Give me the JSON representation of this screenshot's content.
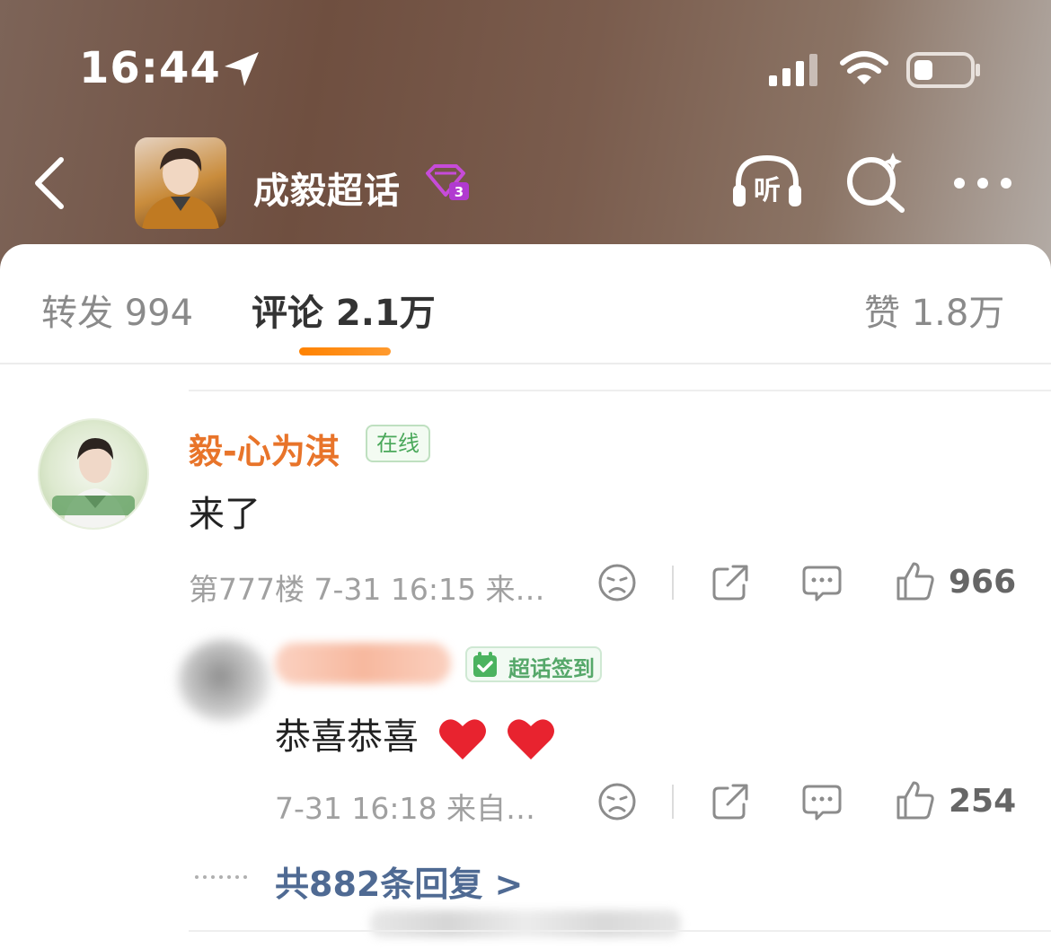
{
  "status_bar": {
    "time": "16:44"
  },
  "header": {
    "title": "成毅超话",
    "level": "3",
    "listen_label": "听"
  },
  "tabs": {
    "repost": "转发 994",
    "comment": "评论 2.1万",
    "like": "赞 1.8万",
    "active": "comment"
  },
  "comment": {
    "username": "毅-心为淇",
    "online_badge": "在线",
    "text": "来了",
    "meta": "第777楼  7-31 16:15  来…",
    "likes": "966"
  },
  "reply": {
    "badge": "超话签到",
    "text": "恭喜恭喜",
    "meta": "7-31 16:18  来自…",
    "likes": "254"
  },
  "view_replies": "共882条回复 >",
  "colors": {
    "accent_orange": "#ff8200",
    "username_orange": "#e8742a",
    "link_blue": "#4f6a93",
    "badge_green": "#4aa85a"
  }
}
